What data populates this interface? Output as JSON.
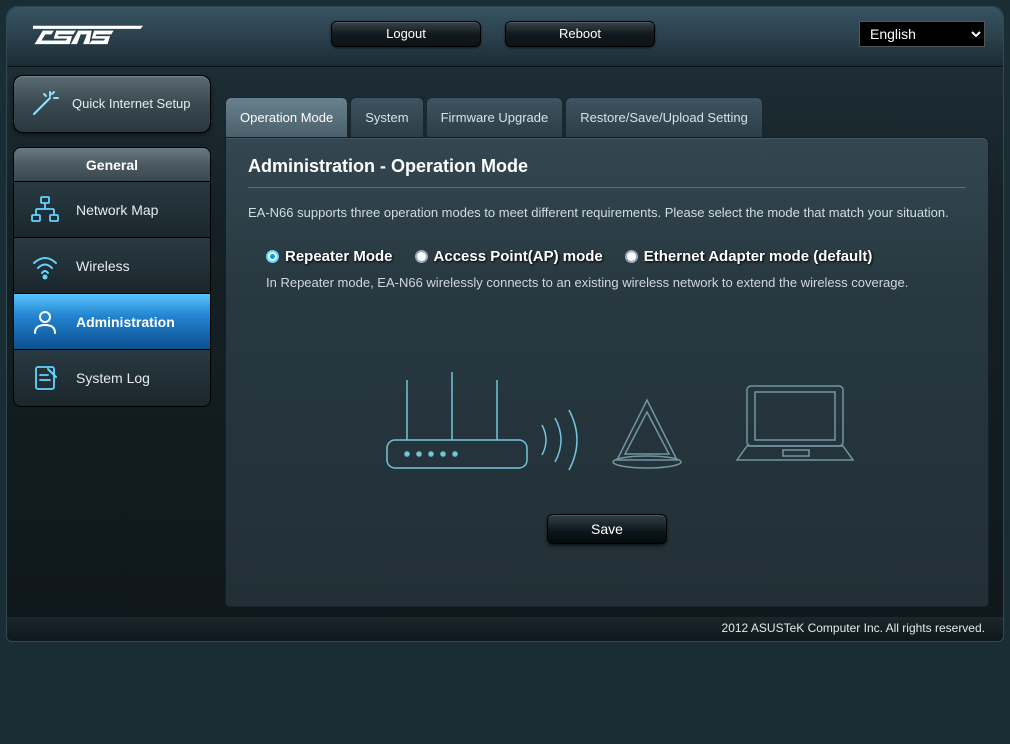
{
  "header": {
    "logout": "Logout",
    "reboot": "Reboot",
    "language": "English"
  },
  "sidebar": {
    "quick_setup": "Quick Internet Setup",
    "general_header": "General",
    "items": [
      {
        "label": "Network Map"
      },
      {
        "label": "Wireless"
      },
      {
        "label": "Administration"
      },
      {
        "label": "System Log"
      }
    ]
  },
  "tabs": [
    {
      "label": "Operation Mode"
    },
    {
      "label": "System"
    },
    {
      "label": "Firmware Upgrade"
    },
    {
      "label": "Restore/Save/Upload Setting"
    }
  ],
  "panel": {
    "title": "Administration - Operation Mode",
    "description": "EA-N66 supports three operation modes to meet different requirements. Please select the mode that match your situation.",
    "modes": [
      {
        "label": "Repeater Mode",
        "selected": true
      },
      {
        "label": "Access Point(AP) mode",
        "selected": false
      },
      {
        "label": "Ethernet Adapter mode (default)",
        "selected": false
      }
    ],
    "mode_description": "In Repeater mode, EA-N66 wirelessly connects to an existing wireless network to extend the wireless coverage.",
    "save": "Save"
  },
  "footer": "2012 ASUSTeK Computer Inc. All rights reserved."
}
